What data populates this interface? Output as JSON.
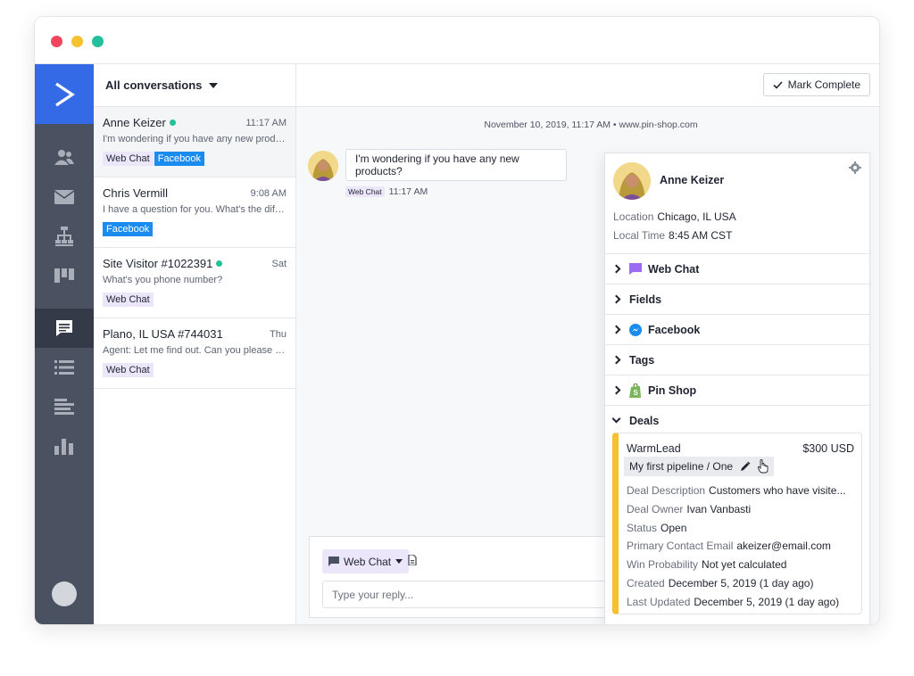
{
  "sidebar": {
    "items": [
      {
        "icon": "contacts-icon"
      },
      {
        "icon": "mail-icon"
      },
      {
        "icon": "automation-icon"
      },
      {
        "icon": "pipeline-icon"
      },
      {
        "icon": "conversations-icon",
        "active": true
      },
      {
        "icon": "lists-icon"
      },
      {
        "icon": "reports-icon"
      },
      {
        "icon": "chart-icon"
      }
    ]
  },
  "conversations": {
    "filter_label": "All conversations",
    "items": [
      {
        "name": "Anne Keizer",
        "online": true,
        "time": "11:17 AM",
        "preview": "I'm wondering if you have any new products?",
        "tags": [
          "Web Chat",
          "Facebook"
        ]
      },
      {
        "name": "Chris Vermill",
        "online": false,
        "time": "9:08 AM",
        "preview": "I have a question for you. What's the difference?",
        "tags": [
          "Facebook"
        ]
      },
      {
        "name": "Site Visitor #1022391",
        "online": true,
        "time": "Sat",
        "preview": "What's you phone number?",
        "tags": [
          "Web Chat"
        ]
      },
      {
        "name": "Plano, IL USA #744031",
        "online": false,
        "time": "Thu",
        "preview": "Agent: Let me find out. Can you please send me",
        "tags": [
          "Web Chat"
        ]
      }
    ]
  },
  "chat": {
    "mark_complete_label": "Mark Complete",
    "date_line": "November 10, 2019, 11:17 AM • www.pin-shop.com",
    "message_text": "I'm wondering if you have any new products?",
    "message_tag": "Web Chat",
    "message_time": "11:17 AM",
    "composer": {
      "channel_label": "Web Chat",
      "placeholder": "Type your reply..."
    }
  },
  "contact_panel": {
    "name": "Anne Keizer",
    "location_label": "Location",
    "location_value": "Chicago, IL USA",
    "local_time_label": "Local Time",
    "local_time_value": "8:45 AM CST",
    "sections": [
      "Web Chat",
      "Fields",
      "Facebook",
      "Tags",
      "Pin Shop",
      "Deals"
    ],
    "deal": {
      "title": "WarmLead",
      "value": "$300 USD",
      "pipeline": "My first pipeline / One",
      "fields": [
        {
          "label": "Deal Description",
          "value": "Customers who have visite..."
        },
        {
          "label": "Deal Owner",
          "value": "Ivan Vanbasti"
        },
        {
          "label": "Status",
          "value": "Open"
        },
        {
          "label": "Primary Contact Email",
          "value": "akeizer@email.com"
        },
        {
          "label": "Win Probability",
          "value": "Not yet calculated"
        },
        {
          "label": "Created",
          "value": "December 5, 2019 (1 day ago)"
        },
        {
          "label": "Last Updated",
          "value": "December 5, 2019 (1 day ago)"
        }
      ]
    }
  },
  "colors": {
    "accent_blue": "#356ae6",
    "sidebar": "#4a5161",
    "online_green": "#23c19b",
    "facebook_blue": "#1a8cf0",
    "webchat_purple": "#ece6fa",
    "deal_yellow": "#f5c12e"
  }
}
